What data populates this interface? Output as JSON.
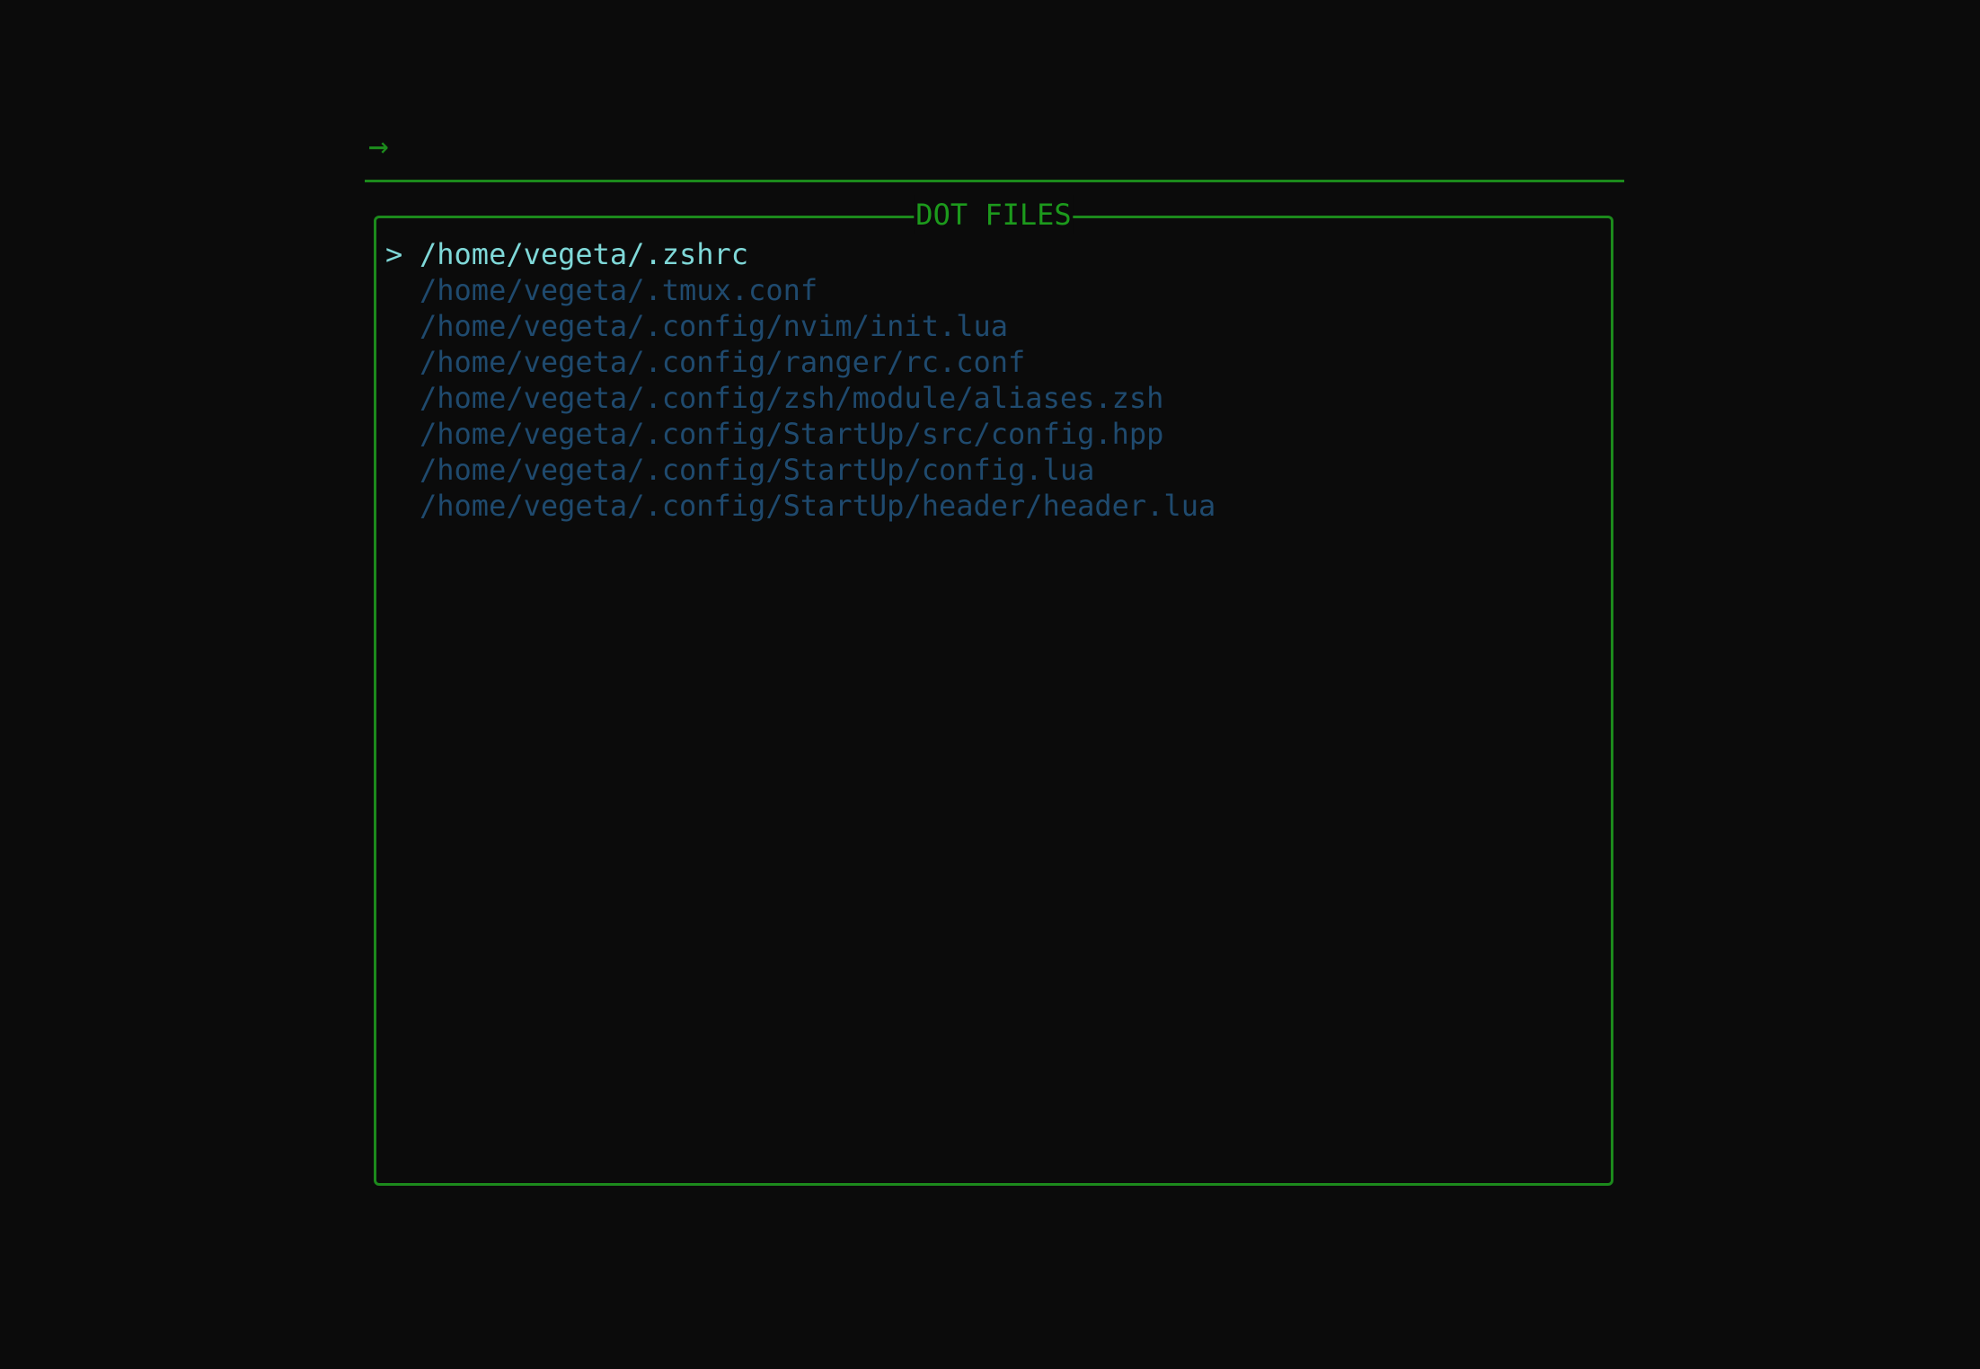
{
  "prompt": {
    "icon": "arrow-right-icon",
    "symbol": "→",
    "value": "",
    "placeholder": ""
  },
  "results": {
    "title": "DOT FILES",
    "selected_marker": ">",
    "selected_index": 0,
    "items": [
      "/home/vegeta/.zshrc",
      "/home/vegeta/.tmux.conf",
      "/home/vegeta/.config/nvim/init.lua",
      "/home/vegeta/.config/ranger/rc.conf",
      "/home/vegeta/.config/zsh/module/aliases.zsh",
      "/home/vegeta/.config/StartUp/src/config.hpp",
      "/home/vegeta/.config/StartUp/config.lua",
      "/home/vegeta/.config/StartUp/header/header.lua"
    ]
  },
  "colors": {
    "background": "#0b0b0b",
    "border": "#1c8a1c",
    "title": "#1c9a1c",
    "selected": "#7fd8d8",
    "unselected": "#1f4a6e"
  }
}
